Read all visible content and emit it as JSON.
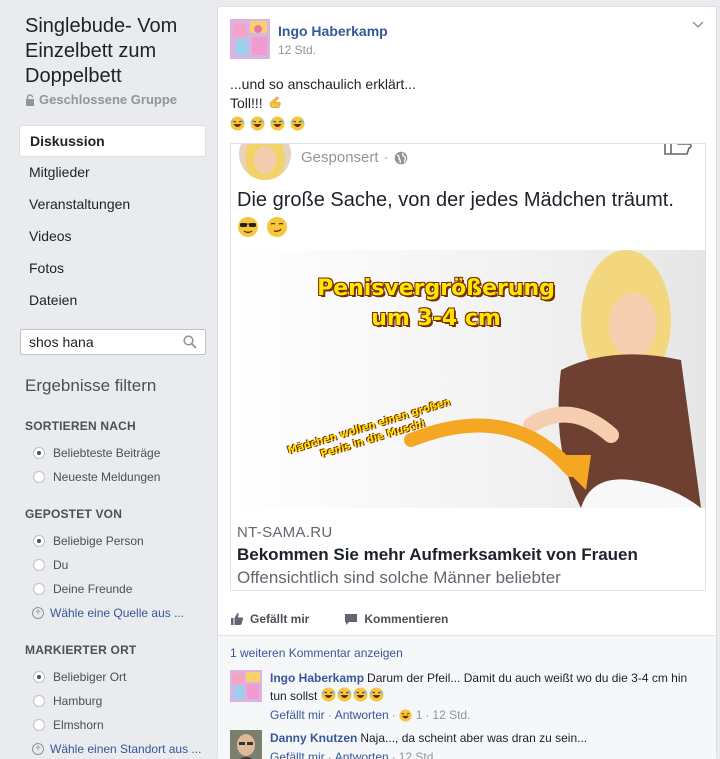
{
  "group": {
    "title": "Singlebude- Vom Einzelbett zum Doppelbett",
    "privacy": "Geschlossene Gruppe"
  },
  "nav": [
    {
      "label": "Diskussion",
      "active": true
    },
    {
      "label": "Mitglieder"
    },
    {
      "label": "Veranstaltungen"
    },
    {
      "label": "Videos"
    },
    {
      "label": "Fotos"
    },
    {
      "label": "Dateien"
    }
  ],
  "search": {
    "value": "shos hana"
  },
  "filters": {
    "title": "Ergebnisse filtern",
    "sort": {
      "heading": "SORTIEREN NACH",
      "options": [
        "Beliebteste Beiträge",
        "Neueste Meldungen"
      ]
    },
    "posted_by": {
      "heading": "GEPOSTET VON",
      "options": [
        "Beliebige Person",
        "Du",
        "Deine Freunde"
      ],
      "add": "Wähle eine Quelle aus ..."
    },
    "location": {
      "heading": "MARKIERTER ORT",
      "options": [
        "Beliebiger Ort",
        "Hamburg",
        "Elmshorn"
      ],
      "add": "Wähle einen Standort aus ..."
    }
  },
  "post": {
    "author": "Ingo Haberkamp",
    "time": "12 Std.",
    "line1": "...und so anschaulich erklärt...",
    "line2": "Toll!!!",
    "shared": {
      "sponsored": "Gesponsert",
      "dot": "·",
      "text": "Die große Sache, von der jedes Mädchen träumt.",
      "image_caption_1": "Penisvergrößerung",
      "image_caption_2": "um 3-4 cm",
      "image_side_1": "Mädchen wollen einen großen",
      "image_side_2": "Penis in die Muschi",
      "domain": "NT-SAMA.RU",
      "headline": "Bekommen Sie mehr Aufmerksamkeit von Frauen",
      "description": "Offensichtlich sind solche Männer beliebter"
    },
    "actions": {
      "like": "Gefällt mir",
      "comment": "Kommentieren"
    },
    "more_comments": "1 weiteren Kommentar anzeigen",
    "comments": [
      {
        "author": "Ingo Haberkamp",
        "text": "Darum der Pfeil... Damit du auch weißt wo du die 3-4 cm hin tun sollst",
        "like": "Gefällt mir",
        "reply": "Antworten",
        "reactions": "1",
        "time": "12 Std.",
        "sep": "·"
      },
      {
        "author": "Danny Knutzen",
        "text": "Naja..., da scheint aber was dran zu sein...",
        "like": "Gefällt mir",
        "reply": "Antworten",
        "time": "12 Std.",
        "sep": "·"
      }
    ]
  },
  "colors": {
    "link": "#365899",
    "background": "#e9ebee",
    "muted": "#90949c"
  }
}
